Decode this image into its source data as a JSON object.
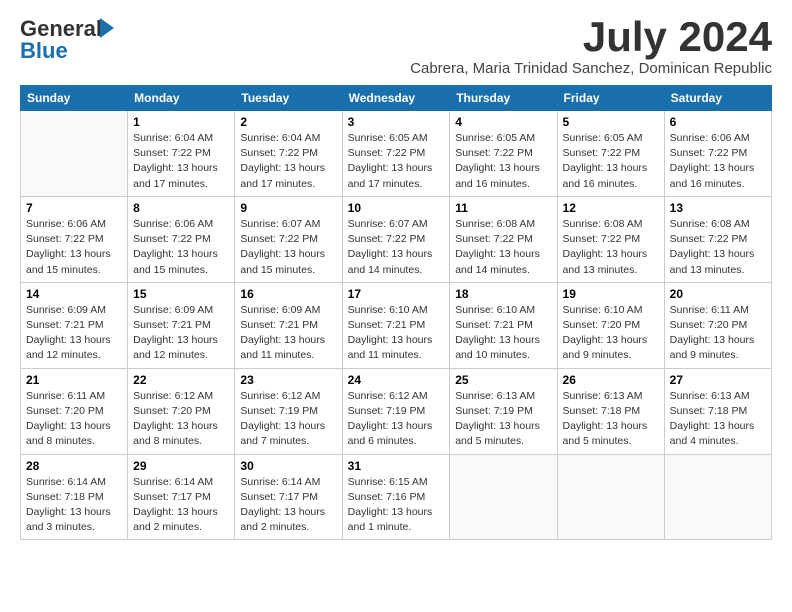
{
  "logo": {
    "line1": "General",
    "line2": "Blue"
  },
  "title": "July 2024",
  "subtitle": "Cabrera, Maria Trinidad Sanchez, Dominican Republic",
  "days_of_week": [
    "Sunday",
    "Monday",
    "Tuesday",
    "Wednesday",
    "Thursday",
    "Friday",
    "Saturday"
  ],
  "weeks": [
    [
      {
        "num": "",
        "info": ""
      },
      {
        "num": "1",
        "info": "Sunrise: 6:04 AM\nSunset: 7:22 PM\nDaylight: 13 hours\nand 17 minutes."
      },
      {
        "num": "2",
        "info": "Sunrise: 6:04 AM\nSunset: 7:22 PM\nDaylight: 13 hours\nand 17 minutes."
      },
      {
        "num": "3",
        "info": "Sunrise: 6:05 AM\nSunset: 7:22 PM\nDaylight: 13 hours\nand 17 minutes."
      },
      {
        "num": "4",
        "info": "Sunrise: 6:05 AM\nSunset: 7:22 PM\nDaylight: 13 hours\nand 16 minutes."
      },
      {
        "num": "5",
        "info": "Sunrise: 6:05 AM\nSunset: 7:22 PM\nDaylight: 13 hours\nand 16 minutes."
      },
      {
        "num": "6",
        "info": "Sunrise: 6:06 AM\nSunset: 7:22 PM\nDaylight: 13 hours\nand 16 minutes."
      }
    ],
    [
      {
        "num": "7",
        "info": "Sunrise: 6:06 AM\nSunset: 7:22 PM\nDaylight: 13 hours\nand 15 minutes."
      },
      {
        "num": "8",
        "info": "Sunrise: 6:06 AM\nSunset: 7:22 PM\nDaylight: 13 hours\nand 15 minutes."
      },
      {
        "num": "9",
        "info": "Sunrise: 6:07 AM\nSunset: 7:22 PM\nDaylight: 13 hours\nand 15 minutes."
      },
      {
        "num": "10",
        "info": "Sunrise: 6:07 AM\nSunset: 7:22 PM\nDaylight: 13 hours\nand 14 minutes."
      },
      {
        "num": "11",
        "info": "Sunrise: 6:08 AM\nSunset: 7:22 PM\nDaylight: 13 hours\nand 14 minutes."
      },
      {
        "num": "12",
        "info": "Sunrise: 6:08 AM\nSunset: 7:22 PM\nDaylight: 13 hours\nand 13 minutes."
      },
      {
        "num": "13",
        "info": "Sunrise: 6:08 AM\nSunset: 7:22 PM\nDaylight: 13 hours\nand 13 minutes."
      }
    ],
    [
      {
        "num": "14",
        "info": "Sunrise: 6:09 AM\nSunset: 7:21 PM\nDaylight: 13 hours\nand 12 minutes."
      },
      {
        "num": "15",
        "info": "Sunrise: 6:09 AM\nSunset: 7:21 PM\nDaylight: 13 hours\nand 12 minutes."
      },
      {
        "num": "16",
        "info": "Sunrise: 6:09 AM\nSunset: 7:21 PM\nDaylight: 13 hours\nand 11 minutes."
      },
      {
        "num": "17",
        "info": "Sunrise: 6:10 AM\nSunset: 7:21 PM\nDaylight: 13 hours\nand 11 minutes."
      },
      {
        "num": "18",
        "info": "Sunrise: 6:10 AM\nSunset: 7:21 PM\nDaylight: 13 hours\nand 10 minutes."
      },
      {
        "num": "19",
        "info": "Sunrise: 6:10 AM\nSunset: 7:20 PM\nDaylight: 13 hours\nand 9 minutes."
      },
      {
        "num": "20",
        "info": "Sunrise: 6:11 AM\nSunset: 7:20 PM\nDaylight: 13 hours\nand 9 minutes."
      }
    ],
    [
      {
        "num": "21",
        "info": "Sunrise: 6:11 AM\nSunset: 7:20 PM\nDaylight: 13 hours\nand 8 minutes."
      },
      {
        "num": "22",
        "info": "Sunrise: 6:12 AM\nSunset: 7:20 PM\nDaylight: 13 hours\nand 8 minutes."
      },
      {
        "num": "23",
        "info": "Sunrise: 6:12 AM\nSunset: 7:19 PM\nDaylight: 13 hours\nand 7 minutes."
      },
      {
        "num": "24",
        "info": "Sunrise: 6:12 AM\nSunset: 7:19 PM\nDaylight: 13 hours\nand 6 minutes."
      },
      {
        "num": "25",
        "info": "Sunrise: 6:13 AM\nSunset: 7:19 PM\nDaylight: 13 hours\nand 5 minutes."
      },
      {
        "num": "26",
        "info": "Sunrise: 6:13 AM\nSunset: 7:18 PM\nDaylight: 13 hours\nand 5 minutes."
      },
      {
        "num": "27",
        "info": "Sunrise: 6:13 AM\nSunset: 7:18 PM\nDaylight: 13 hours\nand 4 minutes."
      }
    ],
    [
      {
        "num": "28",
        "info": "Sunrise: 6:14 AM\nSunset: 7:18 PM\nDaylight: 13 hours\nand 3 minutes."
      },
      {
        "num": "29",
        "info": "Sunrise: 6:14 AM\nSunset: 7:17 PM\nDaylight: 13 hours\nand 2 minutes."
      },
      {
        "num": "30",
        "info": "Sunrise: 6:14 AM\nSunset: 7:17 PM\nDaylight: 13 hours\nand 2 minutes."
      },
      {
        "num": "31",
        "info": "Sunrise: 6:15 AM\nSunset: 7:16 PM\nDaylight: 13 hours\nand 1 minute."
      },
      {
        "num": "",
        "info": ""
      },
      {
        "num": "",
        "info": ""
      },
      {
        "num": "",
        "info": ""
      }
    ]
  ]
}
